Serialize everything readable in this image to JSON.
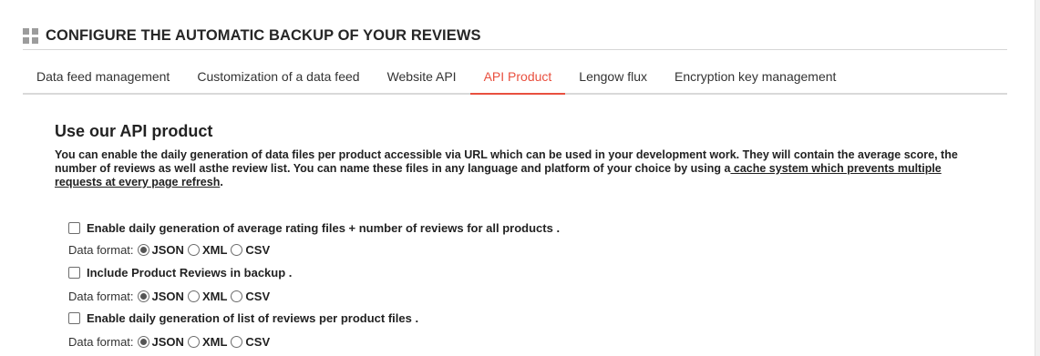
{
  "header": {
    "title": "CONFIGURE THE AUTOMATIC BACKUP OF YOUR REVIEWS",
    "icon": "grid-icon"
  },
  "tabs": [
    {
      "label": "Data feed management",
      "active": false
    },
    {
      "label": "Customization of a data feed",
      "active": false
    },
    {
      "label": "Website API",
      "active": false
    },
    {
      "label": "API Product",
      "active": true
    },
    {
      "label": "Lengow flux",
      "active": false
    },
    {
      "label": "Encryption key management",
      "active": false
    }
  ],
  "section": {
    "title": "Use our API product",
    "intro_text": "You can enable the daily generation of data files per product accessible via URL which can be used in your development work. They will contain the average score, the number of reviews as well asthe review list. You can name these files in any language and platform of your choice by using a",
    "intro_link": " cache system which prevents multiple requests at every page refresh",
    "intro_end": "."
  },
  "options": [
    {
      "label": "Enable daily generation of average rating files + number of reviews for all products .",
      "checked": false,
      "format_label": "Data format:",
      "formats": [
        "JSON",
        "XML",
        "CSV"
      ],
      "selected_format": "JSON"
    },
    {
      "label": "Include Product Reviews in backup .",
      "checked": false,
      "format_label": "Data format:",
      "formats": [
        "JSON",
        "XML",
        "CSV"
      ],
      "selected_format": "JSON"
    },
    {
      "label": "Enable daily generation of list of reviews per product files .",
      "checked": false,
      "format_label": "Data format:",
      "formats": [
        "JSON",
        "XML",
        "CSV"
      ],
      "selected_format": "JSON"
    }
  ],
  "colors": {
    "accent": "#e9503f",
    "text": "#222222",
    "rule": "#d9d9d9"
  }
}
